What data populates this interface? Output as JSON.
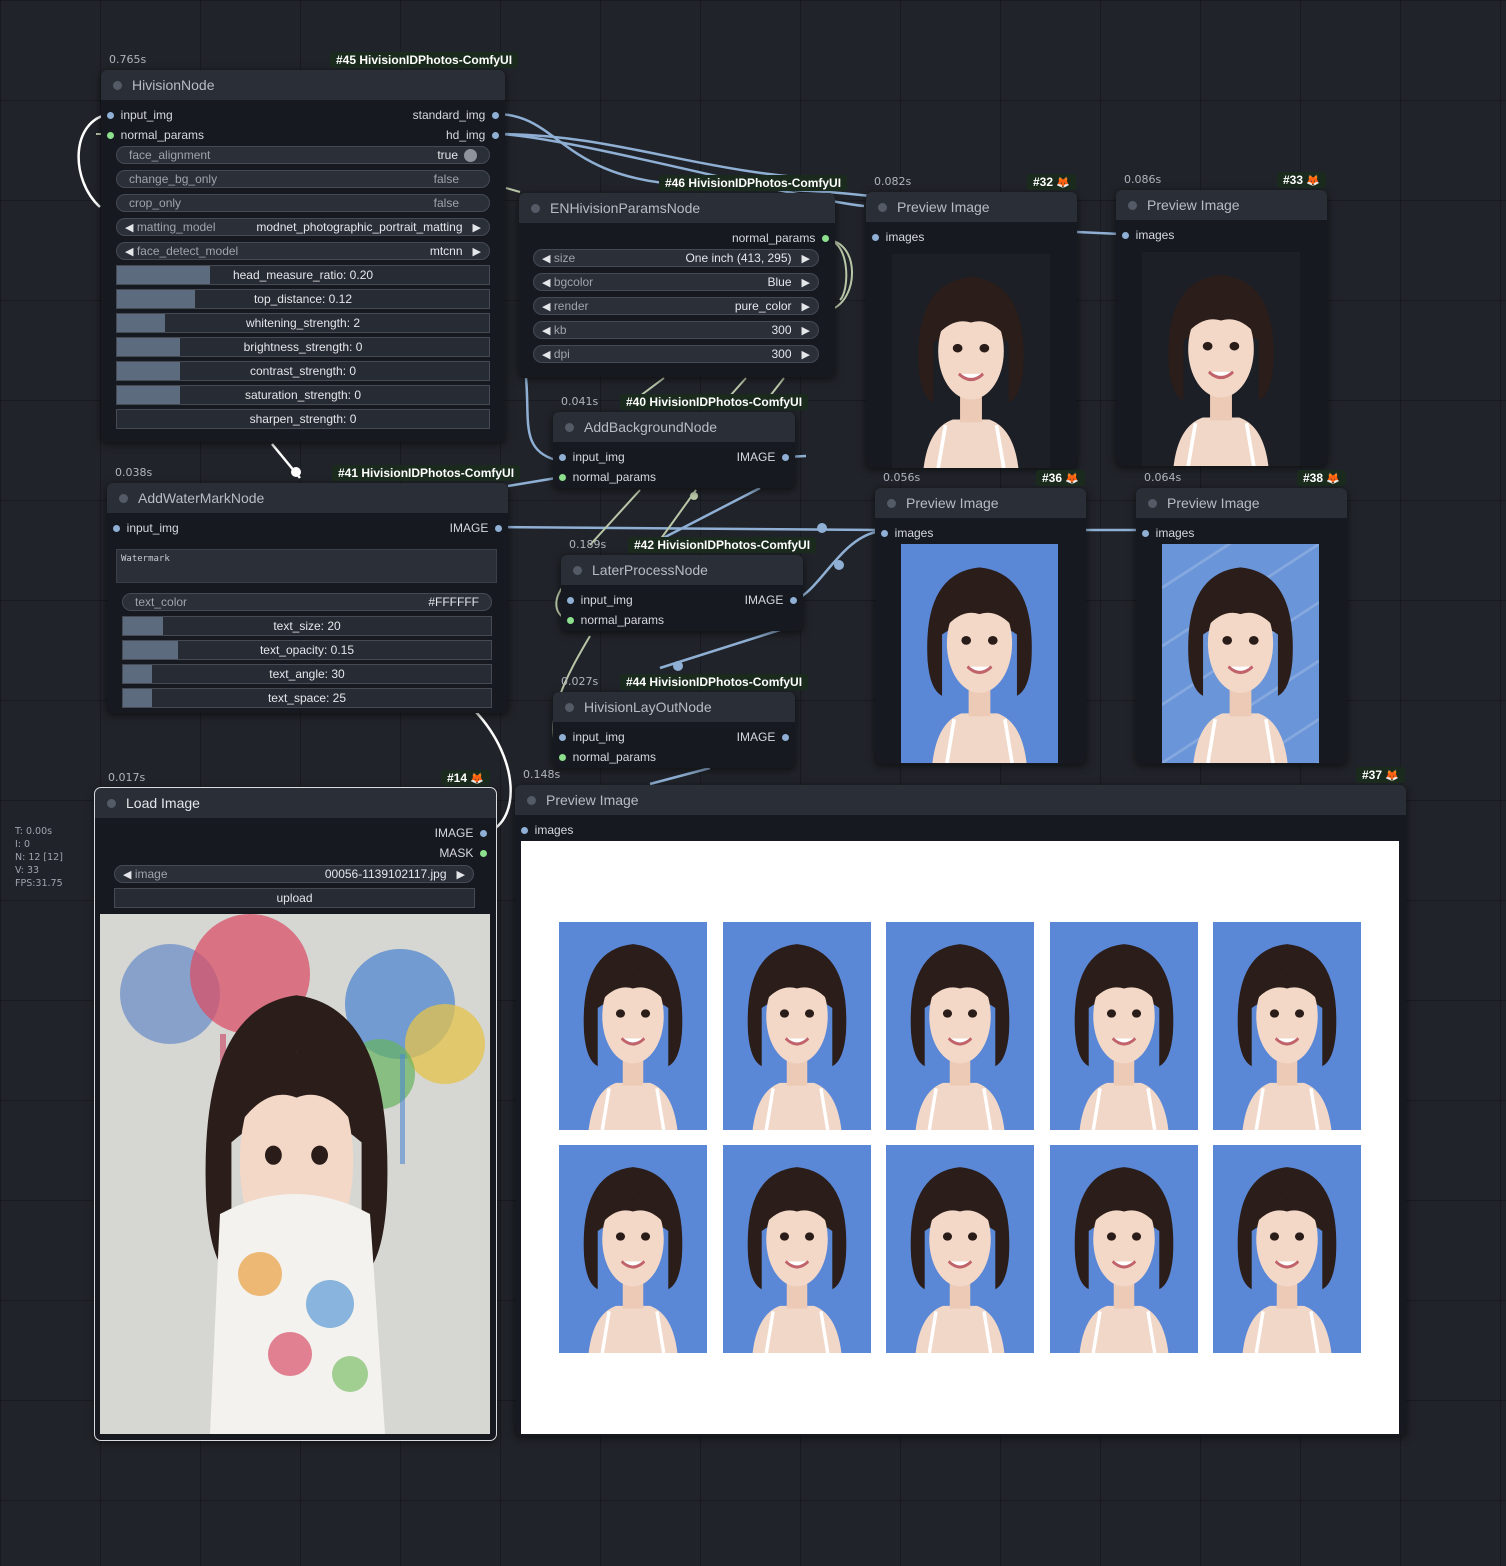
{
  "stats": {
    "t": "T: 0.00s",
    "i": "I: 0",
    "n": "N: 12 [12]",
    "v": "V: 33",
    "fps": "FPS:31.75"
  },
  "nodes": {
    "hivision": {
      "time": "0.765s",
      "badge": "#45 HivisionIDPhotos-ComfyUI",
      "title": "HivisionNode",
      "inputs": [
        "input_img",
        "normal_params"
      ],
      "outputs": [
        "standard_img",
        "hd_img"
      ],
      "toggles": [
        {
          "label": "face_alignment",
          "value": "true"
        },
        {
          "label": "change_bg_only",
          "value": "false"
        },
        {
          "label": "crop_only",
          "value": "false"
        }
      ],
      "combos": [
        {
          "label": "matting_model",
          "value": "modnet_photographic_portrait_matting"
        },
        {
          "label": "face_detect_model",
          "value": "mtcnn"
        }
      ],
      "sliders": [
        {
          "text": "head_measure_ratio: 0.20",
          "fill": 0.25
        },
        {
          "text": "top_distance: 0.12",
          "fill": 0.21
        },
        {
          "text": "whitening_strength: 2",
          "fill": 0.13
        },
        {
          "text": "brightness_strength: 0",
          "fill": 0.17
        },
        {
          "text": "contrast_strength: 0",
          "fill": 0.17
        },
        {
          "text": "saturation_strength: 0",
          "fill": 0.17
        },
        {
          "text": "sharpen_strength: 0",
          "fill": 0.0
        }
      ]
    },
    "params": {
      "badge": "#46 HivisionIDPhotos-ComfyUI",
      "title": "ENHivisionParamsNode",
      "output": "normal_params",
      "combos": [
        {
          "label": "size",
          "value": "One inch  (413, 295)"
        },
        {
          "label": "bgcolor",
          "value": "Blue"
        },
        {
          "label": "render",
          "value": "pure_color"
        },
        {
          "label": "kb",
          "value": "300"
        },
        {
          "label": "dpi",
          "value": "300"
        }
      ]
    },
    "addbg": {
      "time": "0.041s",
      "badge": "#40 HivisionIDPhotos-ComfyUI",
      "title": "AddBackgroundNode",
      "inputs": [
        "input_img",
        "normal_params"
      ],
      "output": "IMAGE"
    },
    "later": {
      "time": "0.189s",
      "badge": "#42 HivisionIDPhotos-ComfyUI",
      "title": "LaterProcessNode",
      "inputs": [
        "input_img",
        "normal_params"
      ],
      "output": "IMAGE"
    },
    "layout": {
      "time": "0.027s",
      "badge": "#44 HivisionIDPhotos-ComfyUI",
      "title": "HivisionLayOutNode",
      "inputs": [
        "input_img",
        "normal_params"
      ],
      "output": "IMAGE"
    },
    "watermark": {
      "time": "0.038s",
      "badge": "#41 HivisionIDPhotos-ComfyUI",
      "title": "AddWaterMarkNode",
      "input": "input_img",
      "output": "IMAGE",
      "text": "Watermark",
      "color_label": "text_color",
      "color_value": "#FFFFFF",
      "sliders": [
        {
          "text": "text_size: 20",
          "fill": 0.11
        },
        {
          "text": "text_opacity: 0.15",
          "fill": 0.15
        },
        {
          "text": "text_angle: 30",
          "fill": 0.08
        },
        {
          "text": "text_space: 25",
          "fill": 0.08
        }
      ]
    },
    "load": {
      "time": "0.017s",
      "badge": "#14",
      "title": "Load Image",
      "outputs": [
        "IMAGE",
        "MASK"
      ],
      "image_label": "image",
      "image_value": "00056-1139102117.jpg",
      "upload": "upload"
    },
    "p32": {
      "time": "0.082s",
      "badge": "#32",
      "title": "Preview Image",
      "input": "images"
    },
    "p33": {
      "time": "0.086s",
      "badge": "#33",
      "title": "Preview Image",
      "input": "images"
    },
    "p36": {
      "time": "0.056s",
      "badge": "#36",
      "title": "Preview Image",
      "input": "images"
    },
    "p38": {
      "time": "0.064s",
      "badge": "#38",
      "title": "Preview Image",
      "input": "images"
    },
    "p37": {
      "time": "0.148s",
      "badge": "#37",
      "title": "Preview Image",
      "input": "images"
    }
  },
  "colors": {
    "canvas": "#202329",
    "node_bg": "#16191f",
    "title_bg": "#2a2e36",
    "id_blue": "#5b88d6",
    "wire": "#8fb0d4",
    "wire_param": "#b9c7a8"
  },
  "layout_sheet": {
    "rows": 2,
    "cols": 5
  }
}
